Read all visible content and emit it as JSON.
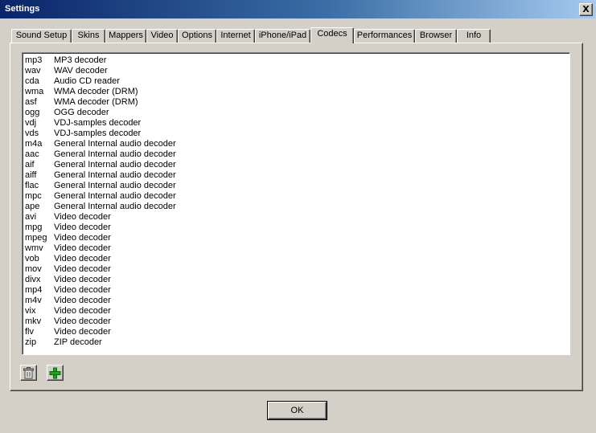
{
  "window": {
    "title": "Settings",
    "close_glyph": "X"
  },
  "tabs": [
    {
      "label": "Sound Setup",
      "active": false
    },
    {
      "label": "Skins",
      "active": false
    },
    {
      "label": "Mappers",
      "active": false
    },
    {
      "label": "Video",
      "active": false
    },
    {
      "label": "Options",
      "active": false
    },
    {
      "label": "Internet",
      "active": false
    },
    {
      "label": "iPhone/iPad",
      "active": false
    },
    {
      "label": "Codecs",
      "active": true
    },
    {
      "label": "Performances",
      "active": false
    },
    {
      "label": "Browser",
      "active": false
    },
    {
      "label": "Info",
      "active": false
    }
  ],
  "codecs": [
    {
      "ext": "mp3",
      "desc": "MP3 decoder"
    },
    {
      "ext": "wav",
      "desc": "WAV decoder"
    },
    {
      "ext": "cda",
      "desc": "Audio CD reader"
    },
    {
      "ext": "wma",
      "desc": "WMA decoder (DRM)"
    },
    {
      "ext": "asf",
      "desc": "WMA decoder (DRM)"
    },
    {
      "ext": "ogg",
      "desc": "OGG decoder"
    },
    {
      "ext": "vdj",
      "desc": "VDJ-samples decoder"
    },
    {
      "ext": "vds",
      "desc": "VDJ-samples decoder"
    },
    {
      "ext": "m4a",
      "desc": "General Internal audio decoder"
    },
    {
      "ext": "aac",
      "desc": "General Internal audio decoder"
    },
    {
      "ext": "aif",
      "desc": "General Internal audio decoder"
    },
    {
      "ext": "aiff",
      "desc": "General Internal audio decoder"
    },
    {
      "ext": "flac",
      "desc": "General Internal audio decoder"
    },
    {
      "ext": "mpc",
      "desc": "General Internal audio decoder"
    },
    {
      "ext": "ape",
      "desc": "General Internal audio decoder"
    },
    {
      "ext": "avi",
      "desc": "Video decoder"
    },
    {
      "ext": "mpg",
      "desc": "Video decoder"
    },
    {
      "ext": "mpeg",
      "desc": "Video decoder"
    },
    {
      "ext": "wmv",
      "desc": "Video decoder"
    },
    {
      "ext": "vob",
      "desc": "Video decoder"
    },
    {
      "ext": "mov",
      "desc": "Video decoder"
    },
    {
      "ext": "divx",
      "desc": "Video decoder"
    },
    {
      "ext": "mp4",
      "desc": "Video decoder"
    },
    {
      "ext": "m4v",
      "desc": "Video decoder"
    },
    {
      "ext": "vix",
      "desc": "Video decoder"
    },
    {
      "ext": "mkv",
      "desc": "Video decoder"
    },
    {
      "ext": "flv",
      "desc": "Video decoder"
    },
    {
      "ext": "zip",
      "desc": "ZIP decoder"
    }
  ],
  "toolbar": {
    "delete_icon": "trash-icon",
    "add_icon": "plus-icon"
  },
  "ok_label": "OK",
  "colors": {
    "titlebar_start": "#0a246a",
    "titlebar_end": "#a6caf0",
    "face": "#d4d0c8",
    "add_green": "#1fa01f"
  }
}
